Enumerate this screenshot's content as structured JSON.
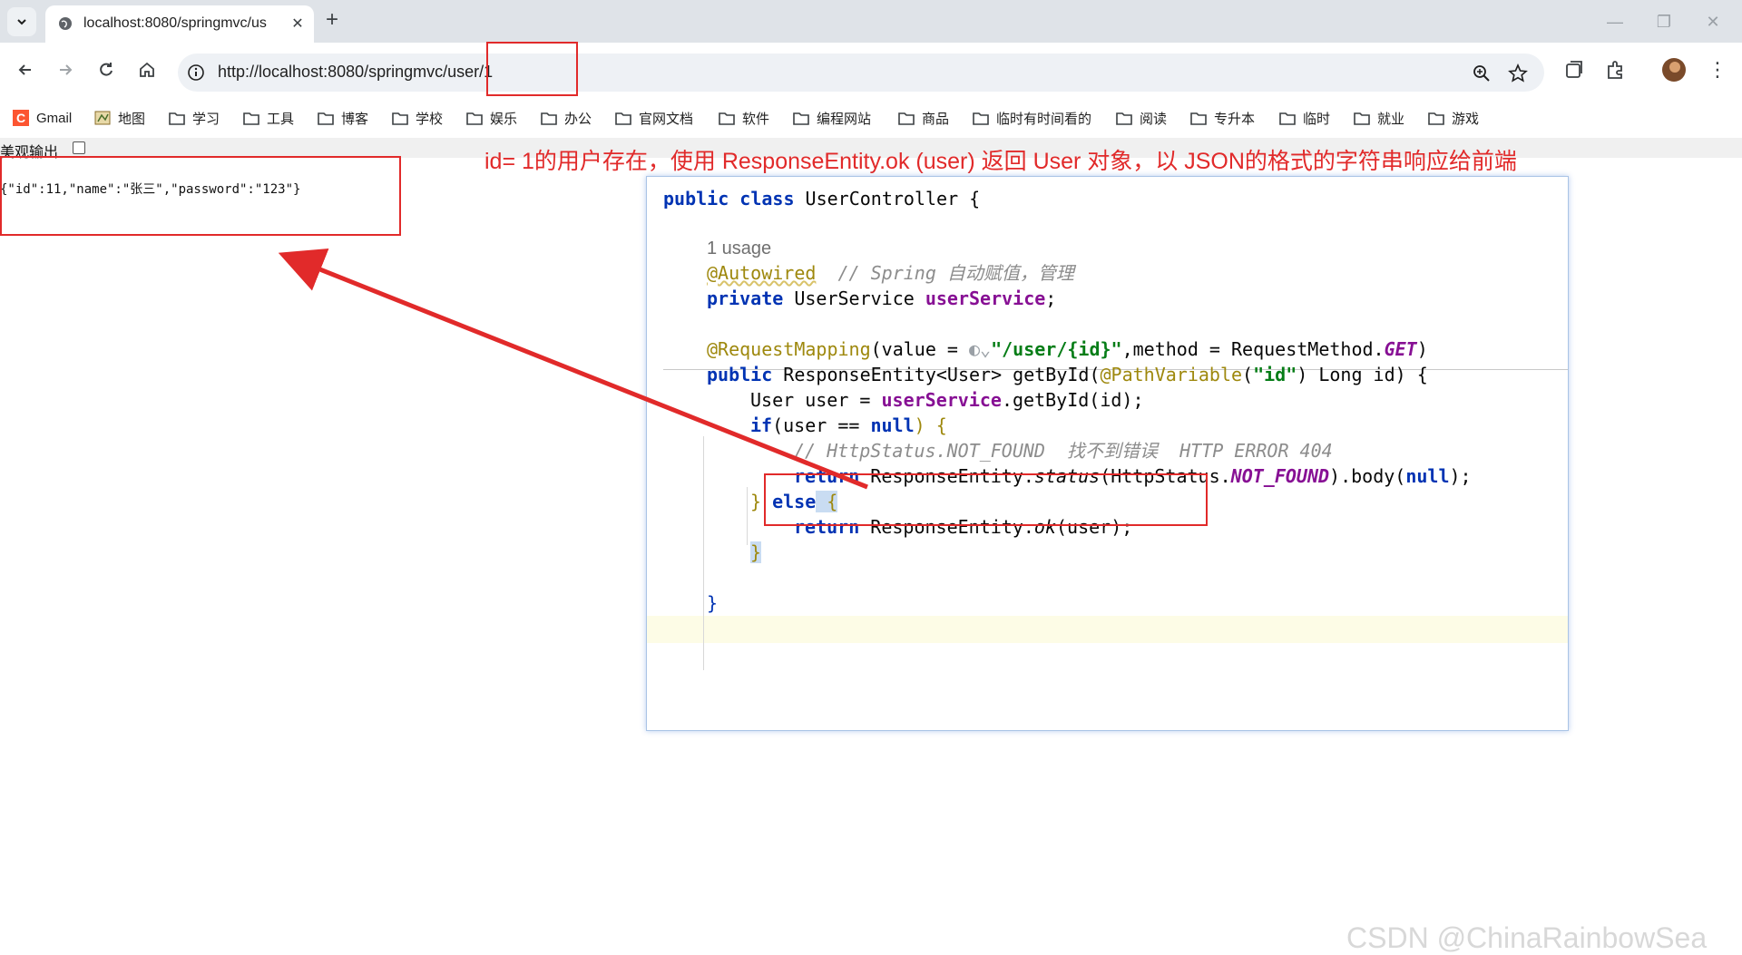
{
  "browser": {
    "tab_title": "localhost:8080/springmvc/us",
    "url": "http://localhost:8080/springmvc/user/1",
    "bookmarks": [
      "Gmail",
      "地图",
      "学习",
      "工具",
      "博客",
      "学校",
      "娱乐",
      "办公",
      "官网文档",
      "软件",
      "编程网站",
      "商品",
      "临时有时间看的",
      "阅读",
      "专升本",
      "临时",
      "就业",
      "游戏"
    ]
  },
  "page": {
    "pretty_label": "美观输出",
    "json_text": "{\"id\":11,\"name\":\"张三\",\"password\":\"123\"}"
  },
  "annotation": "id= 1的用户存在，使用 ResponseEntity.ok (user) 返回  User 对象，以 JSON的格式的字符串响应给前端",
  "code": {
    "class_decl_kw": "public class ",
    "class_name": "UserController {",
    "usage": "1 usage",
    "autowired": "@Autowired",
    "autowired_comment": "// Spring 自动赋值，管理",
    "field_kw": "private ",
    "field_type": "UserService ",
    "field_name": "userService",
    "field_end": ";",
    "mapping": "@RequestMapping",
    "mapping_args_a": "(value = ",
    "mapping_path": "\"/user/{id}\"",
    "mapping_args_b": ",method = RequestMethod.",
    "mapping_get": "GET",
    "mapping_end": ")",
    "method_kw": "public ",
    "method_sig_a": "ResponseEntity<User> getById(",
    "path_variable": "@PathVariable",
    "pv_open": "(",
    "pv_arg": "\"id\"",
    "method_sig_b": ") Long id) {",
    "line_user_a": "User user = ",
    "line_user_field": "userService",
    "line_user_b": ".getById(id);",
    "if_kw": "if",
    "if_a": "(user == ",
    "if_null": "null",
    "if_b": ") {",
    "comment_404": "// HttpStatus.NOT_FOUND  找不到错误  HTTP ERROR 404",
    "ret_kw": "return ",
    "ret_a": "ResponseEntity.",
    "ret_status": "status",
    "ret_b": "(HttpStatus.",
    "ret_not_found": "NOT_FOUND",
    "ret_c": ").body(",
    "ret_null": "null",
    "ret_d": ");",
    "else_a": "} ",
    "else_kw": "else",
    "else_b": " {",
    "ok_kw": "return ",
    "ok_a": "ResponseEntity.",
    "ok_method": "ok",
    "ok_b": "(user);",
    "close_inner": "}",
    "close_method": "}"
  },
  "watermark": "CSDN @ChinaRainbowSea",
  "colors": {
    "annotation_red": "#e12a2a",
    "keyword": "#0033b3",
    "annotation": "#9e880d",
    "string": "#067d17"
  }
}
